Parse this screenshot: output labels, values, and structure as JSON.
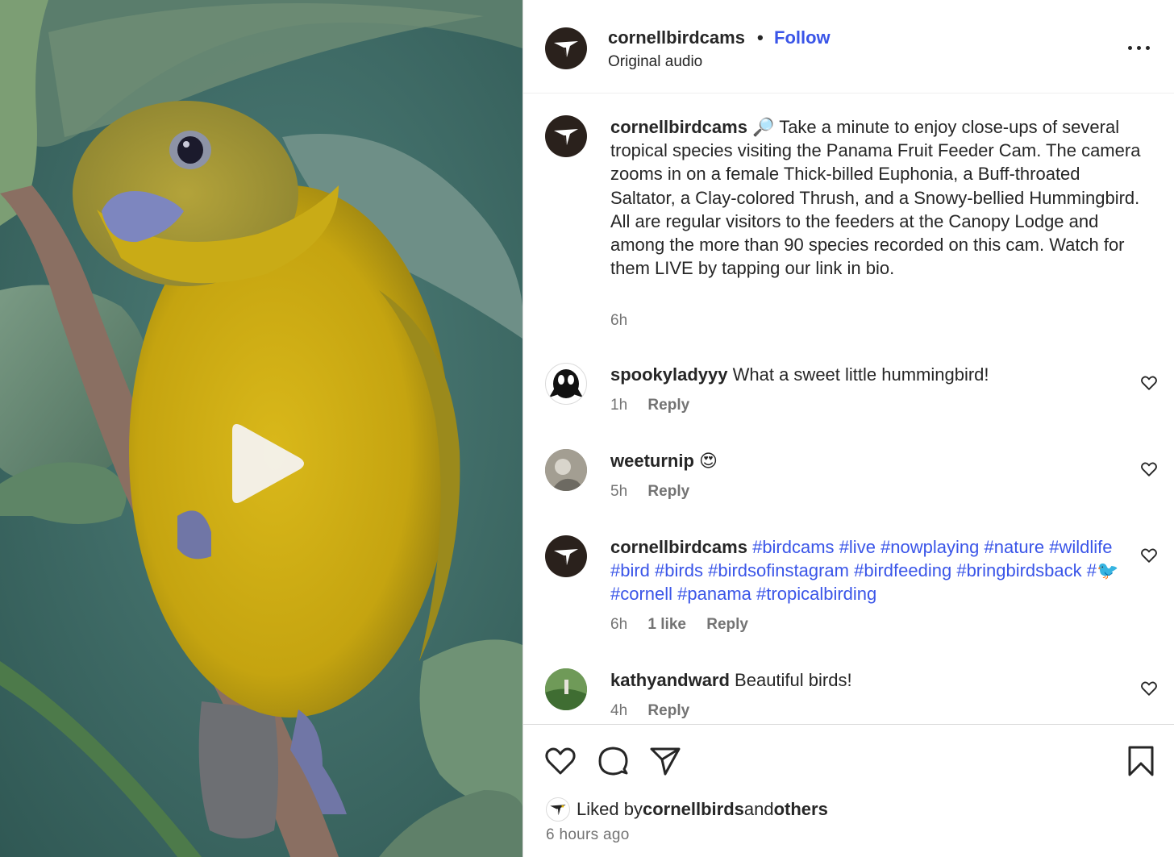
{
  "post": {
    "username": "cornellbirdcams",
    "separator": "•",
    "follow_label": "Follow",
    "audio_label": "Original audio",
    "caption": {
      "username": "cornellbirdcams",
      "emoji": "🔎",
      "text": " Take a minute to enjoy close-ups of several tropical species visiting the Panama Fruit Feeder Cam. The camera zooms in on a female Thick-billed Euphonia, a Buff-throated Saltator, a Clay-colored Thrush, and a Snowy-bellied Hummingbird. All are regular visitors to the feeders at the Canopy Lodge and among the more than 90 species recorded on this cam. Watch for them LIVE by tapping our link in bio.",
      "time": "6h"
    }
  },
  "comments": [
    {
      "username": "spookyladyyy",
      "text": " What a sweet little hummingbird!",
      "time": "1h",
      "reply_label": "Reply"
    },
    {
      "username": "weeturnip",
      "text": " 😍",
      "time": "5h",
      "reply_label": "Reply"
    },
    {
      "username": "cornellbirdcams",
      "hashtags": [
        "#birdcams",
        "#live",
        "#nowplaying",
        "#nature",
        "#wildlife",
        "#bird",
        "#birds",
        "#birdsofinstagram",
        "#birdfeeding",
        "#bringbirdsback",
        "#🐦",
        "#cornell",
        "#panama",
        "#tropicalbirding"
      ],
      "time": "6h",
      "likes_label": "1 like",
      "reply_label": "Reply"
    },
    {
      "username": "kathyandward",
      "text": " Beautiful birds!",
      "time": "4h",
      "reply_label": "Reply"
    }
  ],
  "likes": {
    "prefix": "Liked by ",
    "user": "cornellbirds",
    "middle": " and ",
    "others": "others"
  },
  "timestamp": "6 hours ago",
  "icons": {
    "more": "more-horizontal-icon",
    "play": "play-icon",
    "like": "heart-outline-icon",
    "comment": "comment-bubble-icon",
    "share": "paper-plane-icon",
    "save": "bookmark-icon"
  },
  "colors": {
    "link_blue": "#3a55e8",
    "muted_text": "#737373",
    "text": "#262626",
    "avatar_brown": "#2a211c"
  }
}
